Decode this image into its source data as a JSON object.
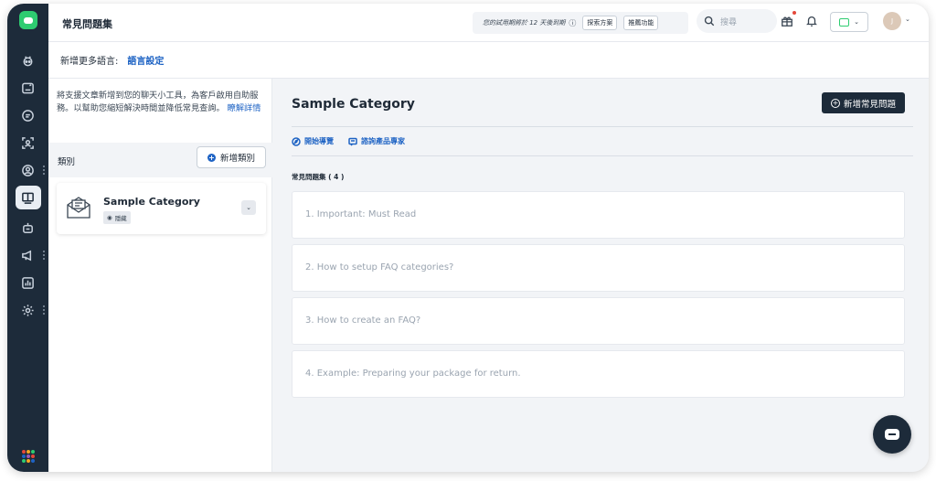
{
  "header": {
    "title": "常見問題集",
    "trial_text": "您的試用期將於 12 天後到期",
    "info_glyph": "ⓘ",
    "explore_plans": "探索方案",
    "recommend_features": "推薦功能",
    "search_placeholder": "搜尋",
    "avatar_initial": "J"
  },
  "subbar": {
    "label": "新增更多語言:",
    "link": "語言設定"
  },
  "left_panel": {
    "intro_text": "將支援文章新增到您的聊天小工具，為客戶啟用自助服務。以幫助您縮短解決時間並降低常見查詢。",
    "intro_link": "瞭解詳情",
    "categories_label": "類別",
    "add_category_button": "新增類別",
    "categories": [
      {
        "name": "Sample Category",
        "status": "隱藏"
      }
    ]
  },
  "main": {
    "heading": "Sample Category",
    "add_faq_button": "新增常見問題",
    "actions": {
      "start_tour": "開始導覽",
      "consult_expert": "諮詢產品專家"
    },
    "faq_count_label": "常見問題集 ( 4 )",
    "faqs": [
      "1. Important: Must Read",
      "2. How to setup FAQ categories?",
      "3. How to create an FAQ?",
      "4. Example: Preparing your package for return."
    ]
  },
  "colors": {
    "rail": "#1d2b3a",
    "accent_blue": "#1e63c4",
    "brand_green": "#2ecc71",
    "notification_red": "#e5483a"
  },
  "icons": {
    "rail": [
      "brand-logo",
      "bot-icon",
      "chat-inbox-icon",
      "message-icon",
      "reports-scan-icon",
      "contacts-icon",
      "knowledge-book-icon",
      "bot-builder-icon",
      "campaign-megaphone-icon",
      "analytics-icon",
      "settings-gear-icon",
      "app-grid-icon"
    ]
  }
}
